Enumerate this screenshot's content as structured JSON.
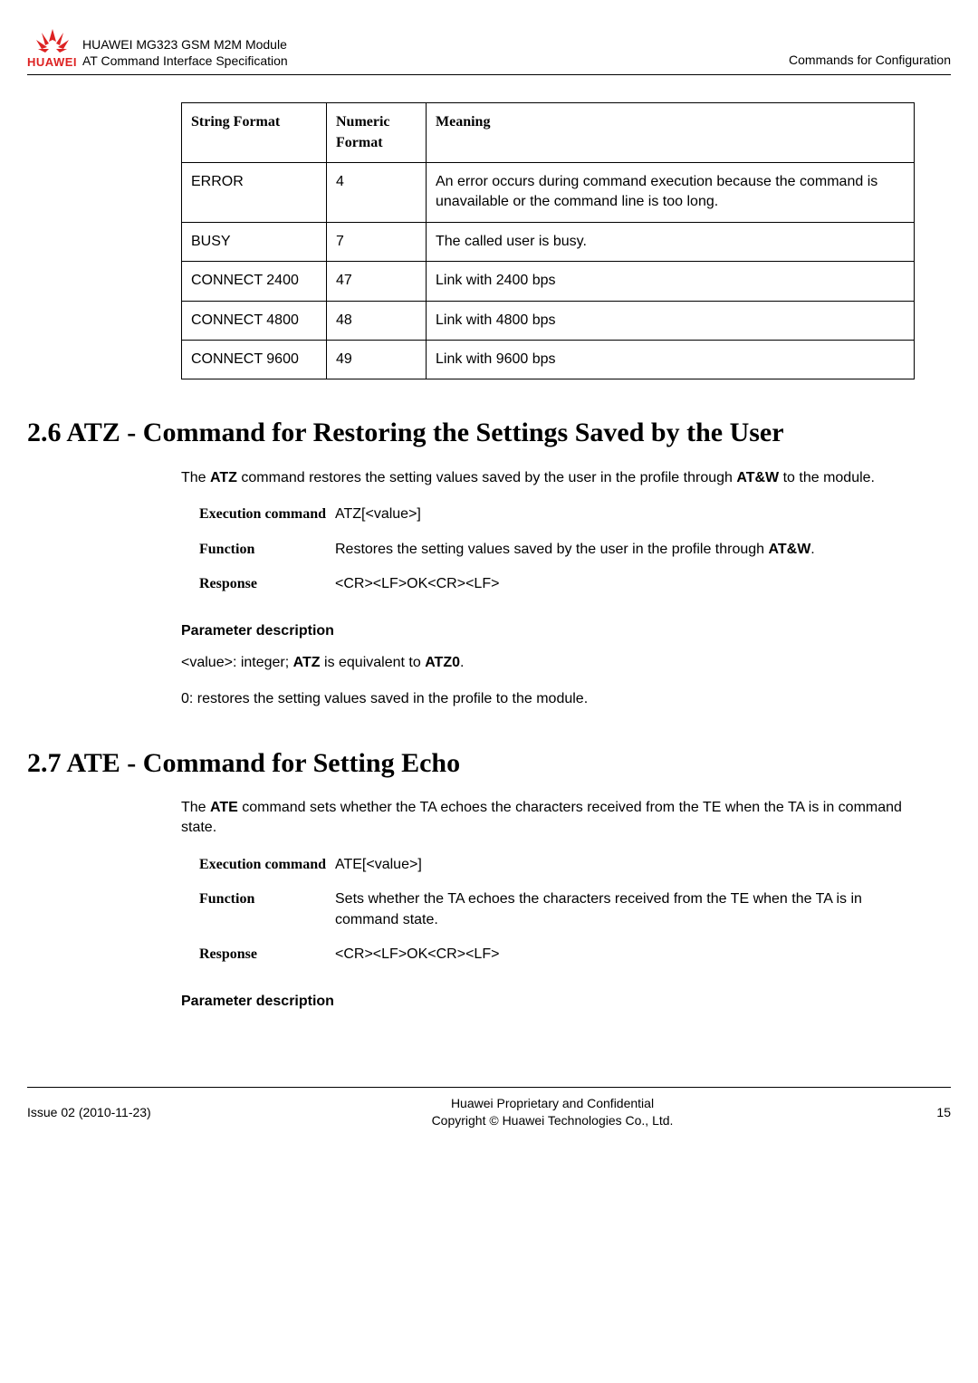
{
  "header": {
    "logo_brand": "HUAWEI",
    "title_line1": "HUAWEI MG323 GSM M2M Module",
    "title_line2": "AT Command Interface Specification",
    "right_text": "Commands for Configuration"
  },
  "table1": {
    "headers": {
      "c1": "String Format",
      "c2": "Numeric Format",
      "c3": "Meaning"
    },
    "rows": [
      {
        "c1": "ERROR",
        "c2": "4",
        "c3": "An error occurs during command execution because the command is unavailable or the command line is too long."
      },
      {
        "c1": "BUSY",
        "c2": "7",
        "c3": "The called user is busy."
      },
      {
        "c1": "CONNECT 2400",
        "c2": "47",
        "c3": "Link with 2400 bps"
      },
      {
        "c1": "CONNECT 4800",
        "c2": "48",
        "c3": "Link with 4800 bps"
      },
      {
        "c1": "CONNECT 9600",
        "c2": "49",
        "c3": "Link with 9600 bps"
      }
    ]
  },
  "section26": {
    "heading": "2.6 ATZ - Command for Restoring the Settings Saved by the User",
    "intro_pre": "The ",
    "intro_bold1": "ATZ",
    "intro_mid": " command restores the setting values saved by the user in the profile through ",
    "intro_bold2": "AT&W",
    "intro_post": " to the module.",
    "exec_label": "Execution command",
    "exec_val": "ATZ[<value>]",
    "func_label": "Function",
    "func_pre": "Restores the setting values saved by the user in the profile through ",
    "func_bold": "AT&W",
    "func_post": ".",
    "resp_label": "Response",
    "resp_val": "<CR><LF>OK<CR><LF>",
    "param_heading": "Parameter description",
    "param_line1_pre": "<value>: integer; ",
    "param_line1_b1": "ATZ",
    "param_line1_mid": " is equivalent to ",
    "param_line1_b2": "ATZ0",
    "param_line1_post": ".",
    "param_line2": "0: restores the setting values saved in the profile to the module."
  },
  "section27": {
    "heading": "2.7 ATE - Command for Setting Echo",
    "intro_pre": "The ",
    "intro_bold1": "ATE",
    "intro_post": " command sets whether the TA echoes the characters received from the TE when the TA is in command state.",
    "exec_label": "Execution command",
    "exec_val": "ATE[<value>]",
    "func_label": "Function",
    "func_val": "Sets whether the TA echoes the characters received from the TE when the TA is in command state.",
    "resp_label": "Response",
    "resp_val": "<CR><LF>OK<CR><LF>",
    "param_heading": "Parameter description"
  },
  "footer": {
    "left": "Issue 02 (2010-11-23)",
    "center_line1": "Huawei Proprietary and Confidential",
    "center_line2": "Copyright © Huawei Technologies Co., Ltd.",
    "right": "15"
  }
}
